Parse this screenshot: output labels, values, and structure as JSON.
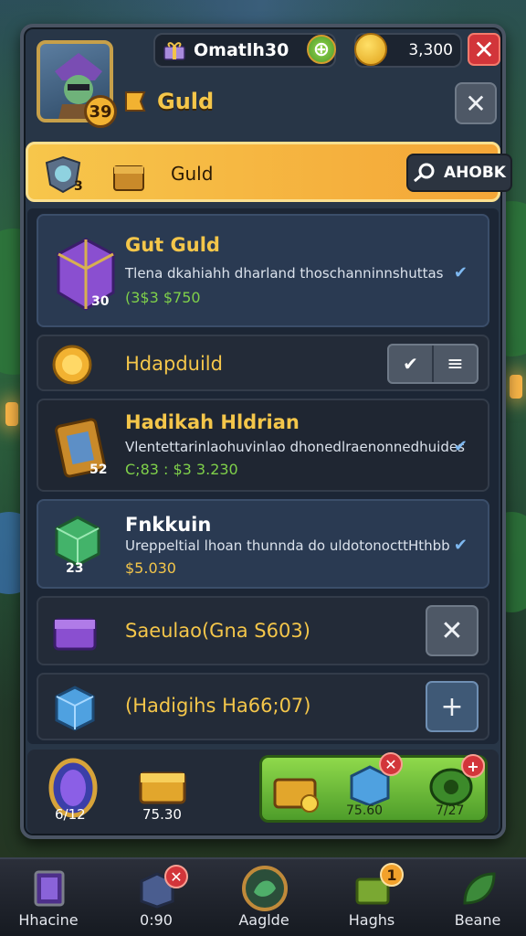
{
  "header": {
    "player_name": "Omatlh30",
    "currency": "3,300",
    "level": "39",
    "title": "Guld"
  },
  "banner": {
    "label": "Guld",
    "badge": "3",
    "button_label": "AHOBK"
  },
  "rows": [
    {
      "name": "Gut Guld",
      "desc": "Tlena dkahiahh dharland thoschanninnshuttas",
      "price": "(3$3 $750",
      "badge": "30",
      "check": "✔"
    },
    {
      "name": "Hdapduild",
      "check_button": "✔",
      "list_button": "≡"
    },
    {
      "name": "Hadikah Hldrian",
      "desc": "Vlentettarinlaohuvinlao dhonedlraenonnedhuides",
      "price": "C;83 : $3 3.230",
      "badge": "52",
      "check": "✔"
    },
    {
      "name": "Fnkkuin",
      "desc": "Ureppeltial lhoan thunnda do uldotonocttHthbb",
      "price": "$5.030",
      "badge": "23",
      "check": "✔"
    },
    {
      "name": "Saeulao(Gna S603)",
      "button": "✕"
    },
    {
      "name": "(Hadigihs Ha66;07)",
      "button": "+"
    }
  ],
  "tray": {
    "item1_value": "6/12",
    "item2_value": "75.30",
    "green_item2_value": "75.60",
    "green_item3_value": "7/27"
  },
  "nav": [
    {
      "label": "Hhacine"
    },
    {
      "label": "0:90"
    },
    {
      "label": "Aaglde"
    },
    {
      "label": "Haghs",
      "badge": "1"
    },
    {
      "label": "Beane"
    }
  ]
}
